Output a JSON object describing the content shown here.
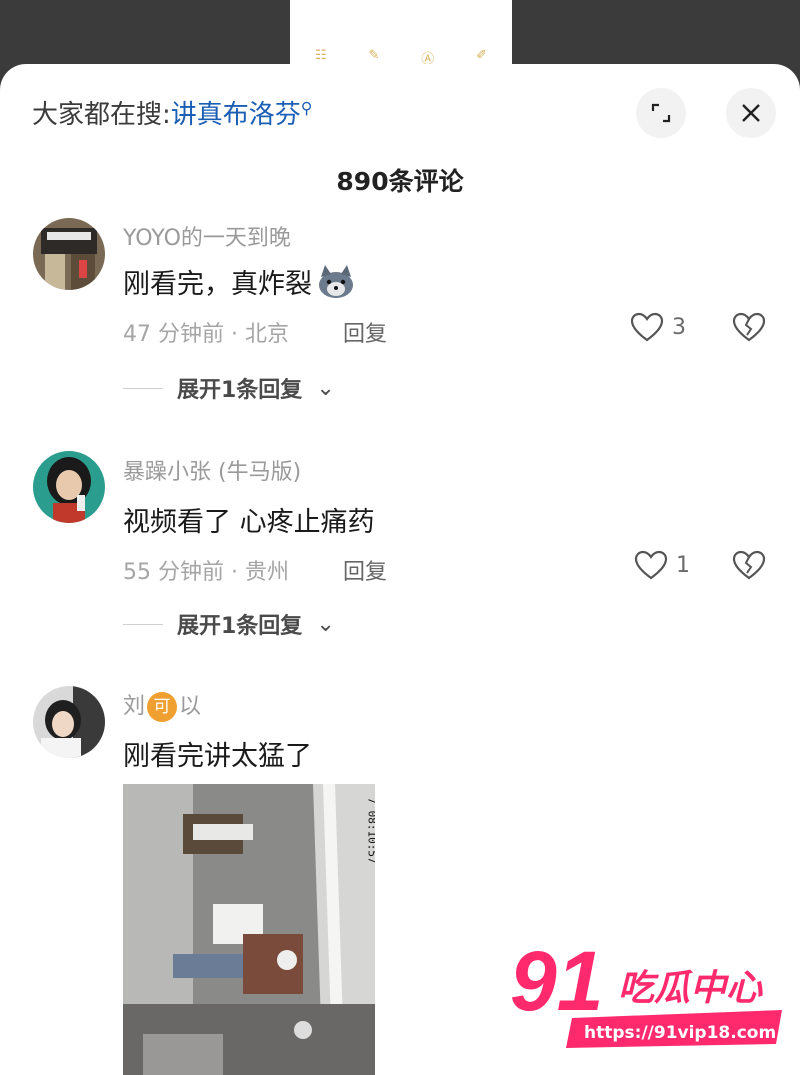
{
  "search": {
    "prefix": "大家都在搜:",
    "term": "讲真布洛芬",
    "icon": "search-icon"
  },
  "header": {
    "comment_count": "890条评论"
  },
  "comments": [
    {
      "username": "YOYO的一天到晚",
      "text": "刚看完，真炸裂",
      "emoji": "wolf-face-icon",
      "time_location": "47 分钟前 · 北京",
      "reply_label": "回复",
      "likes": "3",
      "expand_label": "展开1条回复"
    },
    {
      "username": "暴躁小张 (牛马版)",
      "text": "视频看了 心疼止痛药",
      "time_location": "55 分钟前 · 贵州",
      "reply_label": "回复",
      "likes": "1",
      "expand_label": "展开1条回复"
    },
    {
      "username_before": "刘",
      "username_badge": "可",
      "username_after": "以",
      "text": "刚看完讲太猛了",
      "video_timestamp": "7 08:10:57"
    }
  ],
  "watermark": {
    "number": "91",
    "text": "吃瓜中心",
    "url": "https://91vip18.com"
  },
  "colors": {
    "link": "#1b5fb4",
    "accent_pink": "#ff2a6d",
    "badge": "#f0a030"
  }
}
